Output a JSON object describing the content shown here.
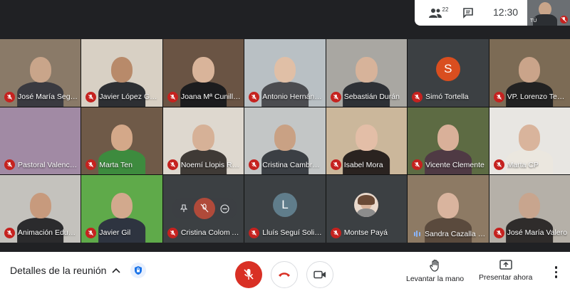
{
  "topbar": {
    "participants_icon": "people-icon",
    "participants_count": "22",
    "chat_icon": "chat-icon",
    "time": "12:30",
    "self_label": "TÚ"
  },
  "tiles": [
    {
      "name": "José María Segu…",
      "muted": true,
      "bg": "#8a7a68",
      "skin": "#c9a58a",
      "shirt": "#3a3a40"
    },
    {
      "name": "Javier López Gu…",
      "muted": true,
      "bg": "#d8d0c4",
      "skin": "#b88a6a",
      "shirt": "#2d2f33"
    },
    {
      "name": "Joana Mª Cunill…",
      "muted": true,
      "bg": "#6a5444",
      "skin": "#d9b49a",
      "shirt": "#1c1c1e"
    },
    {
      "name": "Antonio Hernánd…",
      "muted": true,
      "bg": "#b9c0c4",
      "skin": "#e0bfa6",
      "shirt": "#4b4c50"
    },
    {
      "name": "Sebastián Durán",
      "muted": true,
      "bg": "#a9a7a2",
      "skin": "#d7b39a",
      "shirt": "#2e3136"
    },
    {
      "name": "Simó Tortella",
      "muted": true,
      "avatar": "S",
      "avatar_color": "#d94e1f",
      "bg": "#3c4043"
    },
    {
      "name": "VP. Lorenzo Teba…",
      "muted": true,
      "bg": "#7c6b55",
      "skin": "#caa48a",
      "shirt": "#222"
    },
    {
      "name": "Pastoral Valenci…",
      "muted": true,
      "bg": "#a18aa4",
      "skin": "#b091a8",
      "shirt": "#8a6f8e",
      "empty": true
    },
    {
      "name": "Marta Ten",
      "muted": true,
      "bg": "#6f5a48",
      "skin": "#d4a889",
      "shirt": "#3d8b3e"
    },
    {
      "name": "Noemí Llopis Ruiz",
      "muted": true,
      "bg": "#ded8cf",
      "skin": "#d6b197",
      "shirt": "#3f3a36"
    },
    {
      "name": "Cristina Cambro…",
      "muted": true,
      "bg": "#c3c6c6",
      "skin": "#c9a184",
      "shirt": "#3b3f44"
    },
    {
      "name": "Isabel Mora",
      "muted": true,
      "bg": "#cbb79b",
      "skin": "#e3bea7",
      "shirt": "#2a2320"
    },
    {
      "name": "Vicente Clemente",
      "muted": true,
      "bg": "#5d6b43",
      "skin": "#d9b099",
      "shirt": "#4f3a44"
    },
    {
      "name": "Marta CP",
      "muted": true,
      "bg": "#e8e6e2",
      "skin": "#d9b49c",
      "shirt": "#ebe7df"
    },
    {
      "name": "Animación Educ…",
      "muted": true,
      "bg": "#c4c2bd",
      "skin": "#c79a7d",
      "shirt": "#2b2b2d"
    },
    {
      "name": "Javier Gil",
      "muted": true,
      "bg": "#5faa4a",
      "skin": "#d2a98d",
      "shirt": "#2e3440"
    },
    {
      "name": "Cristina Colom A…",
      "muted": true,
      "bg": "#3c4043",
      "hover": true
    },
    {
      "name": "Lluís Seguí Soliv…",
      "muted": true,
      "avatar": "L",
      "avatar_color": "#607d8b",
      "bg": "#3c4043"
    },
    {
      "name": "Montse Payá",
      "muted": true,
      "photo": true,
      "bg": "#3c4043"
    },
    {
      "name": "Sandra Cazalla R…",
      "muted": false,
      "speaking": true,
      "bg": "#8d7a64",
      "skin": "#d9b49e",
      "shirt": "#5a4a3d"
    },
    {
      "name": "José María Valero",
      "muted": true,
      "bg": "#b5b0a8",
      "skin": "#c8a58e",
      "shirt": "#2f2c2b"
    }
  ],
  "bottombar": {
    "meeting_details": "Detalles de la reunión",
    "raise_hand": "Levantar la mano",
    "present_now": "Presentar ahora"
  },
  "colors": {
    "red": "#c5221f",
    "accent": "#1a73e8"
  }
}
